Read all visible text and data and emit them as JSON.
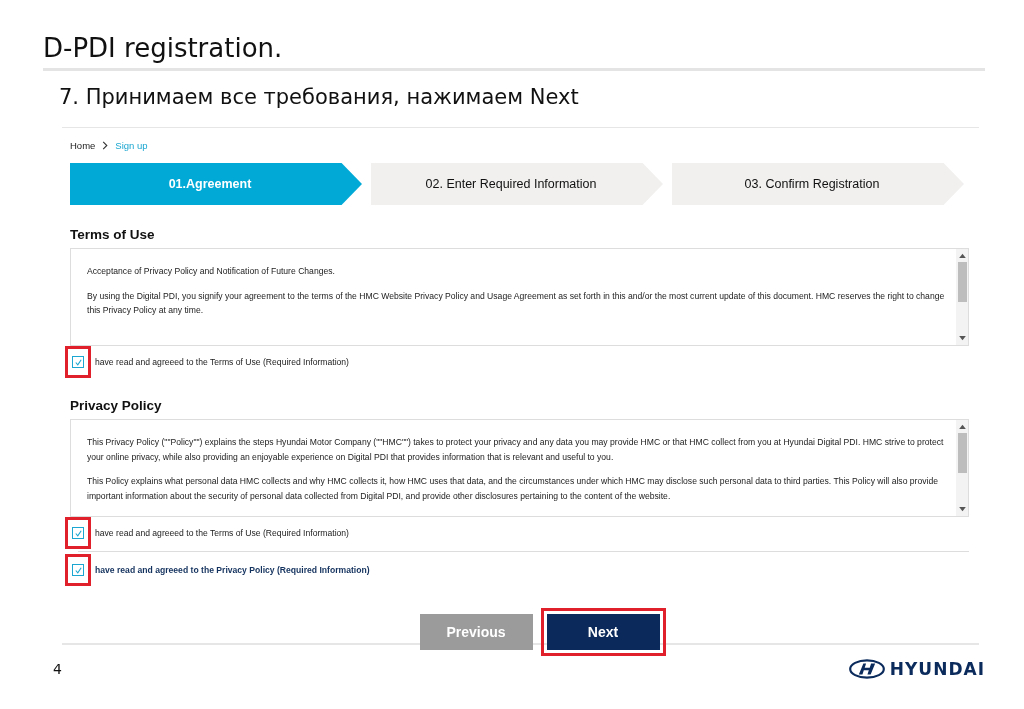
{
  "slide": {
    "title": "D-PDI registration.",
    "subtitle": "7. Принимаем все требования, нажимаем Next",
    "page_number": "4",
    "logo": "HYUNDAI"
  },
  "breadcrumb": [
    {
      "label": "Home",
      "selected": false
    },
    {
      "label": "Sign up",
      "selected": true
    }
  ],
  "steps": [
    {
      "label": "01.Agreement",
      "selected": true
    },
    {
      "label": "02. Enter Required Information",
      "selected": false
    },
    {
      "label": "03. Confirm Registration",
      "selected": false
    }
  ],
  "sections": [
    {
      "title": "Terms of Use",
      "paragraphs": [
        "Acceptance of Privacy Policy and Notification of Future Changes.",
        "By using the Digital PDI, you signify your agreement to the terms of the HMC Website Privacy Policy and Usage Agreement as set forth in this and/or the most current update of this document. HMC reserves the right to change this Privacy Policy at any time."
      ],
      "agreement": {
        "label": "have read and agreeed to the Terms of Use (Required Information)",
        "checked": true,
        "highlighted": true
      }
    },
    {
      "title": "Privacy Policy",
      "paragraphs": [
        "This Privacy Policy (\"\"Policy\"\") explains the steps Hyundai Motor Company (\"\"HMC\"\") takes to protect your privacy and any data you may provide HMC or that HMC collect from you at Hyundai Digital PDI. HMC strive to protect your online privacy, while also providing an enjoyable experience on Digital PDI that provides information that is relevant and useful to you.",
        "This Policy explains what personal data HMC collects and why HMC collects it, how HMC uses that data, and the circumstances under which HMC may disclose such personal data to third parties. This Policy will also provide important information about the security of personal data collected from Digital PDI, and provide other disclosures pertaining to the content of the website."
      ],
      "agreement": {
        "label": "have read and agreeed to the Terms of Use (Required Information)",
        "checked": true,
        "highlighted": true
      }
    }
  ],
  "final_agreement": {
    "label": "have read and agreeed to the Privacy Policy (Required Information)",
    "checked": true,
    "highlighted": true
  },
  "buttons": [
    {
      "label": "Previous",
      "kind": "secondary",
      "highlighted": false
    },
    {
      "label": "Next",
      "kind": "primary",
      "highlighted": true
    }
  ]
}
